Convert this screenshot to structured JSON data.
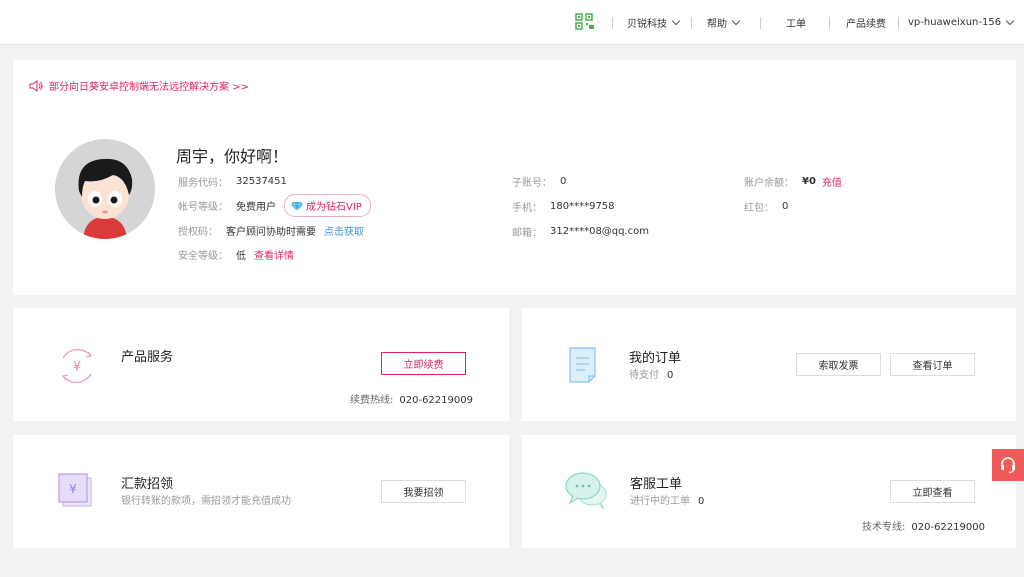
{
  "header": {
    "company": "贝锐科技",
    "help": "帮助",
    "ticket": "工单",
    "renew": "产品续费",
    "account": "vp-huaweixun-156"
  },
  "notice": "部分向日葵安卓控制端无法远控解决方案 >>",
  "profile": {
    "greeting": "周宇，你好啊！",
    "service_code_label": "服务代码：",
    "service_code": "32537451",
    "level_label": "帐号等级：",
    "level": "免费用户",
    "vip_button": "成为钻石VIP",
    "auth_label": "授权码：",
    "auth_value": "客户顾问协助时需要",
    "auth_link": "点击获取",
    "security_label": "安全等级：",
    "security_value": "低",
    "security_link": "查看详情",
    "sub_label": "子账号：",
    "sub_value": "0",
    "phone_label": "手机：",
    "phone": "180****9758",
    "email_label": "邮箱：",
    "email": "312****08@qq.com",
    "balance_label": "账户余额：",
    "balance": "¥0",
    "recharge": "充值",
    "redpack_label": "红包：",
    "redpack": "0"
  },
  "cards": {
    "product": {
      "title": "产品服务",
      "button": "立即续费",
      "hotline_label": "续费热线:",
      "hotline": "020-62219009"
    },
    "orders": {
      "title": "我的订单",
      "sub_label": "待支付",
      "sub_value": "0",
      "btn_invoice": "索取发票",
      "btn_view": "查看订单"
    },
    "remit": {
      "title": "汇款招领",
      "sub": "银行转账的款项，需招领才能充值成功",
      "button": "我要招领"
    },
    "service": {
      "title": "客服工单",
      "sub_label": "进行中的工单",
      "sub_value": "0",
      "button": "立即查看",
      "hotline_label": "技术专线:",
      "hotline": "020-62219000"
    }
  },
  "colors": {
    "accent": "#e0245e",
    "link": "#3d8fe0",
    "cs_float": "#f05a5a"
  }
}
